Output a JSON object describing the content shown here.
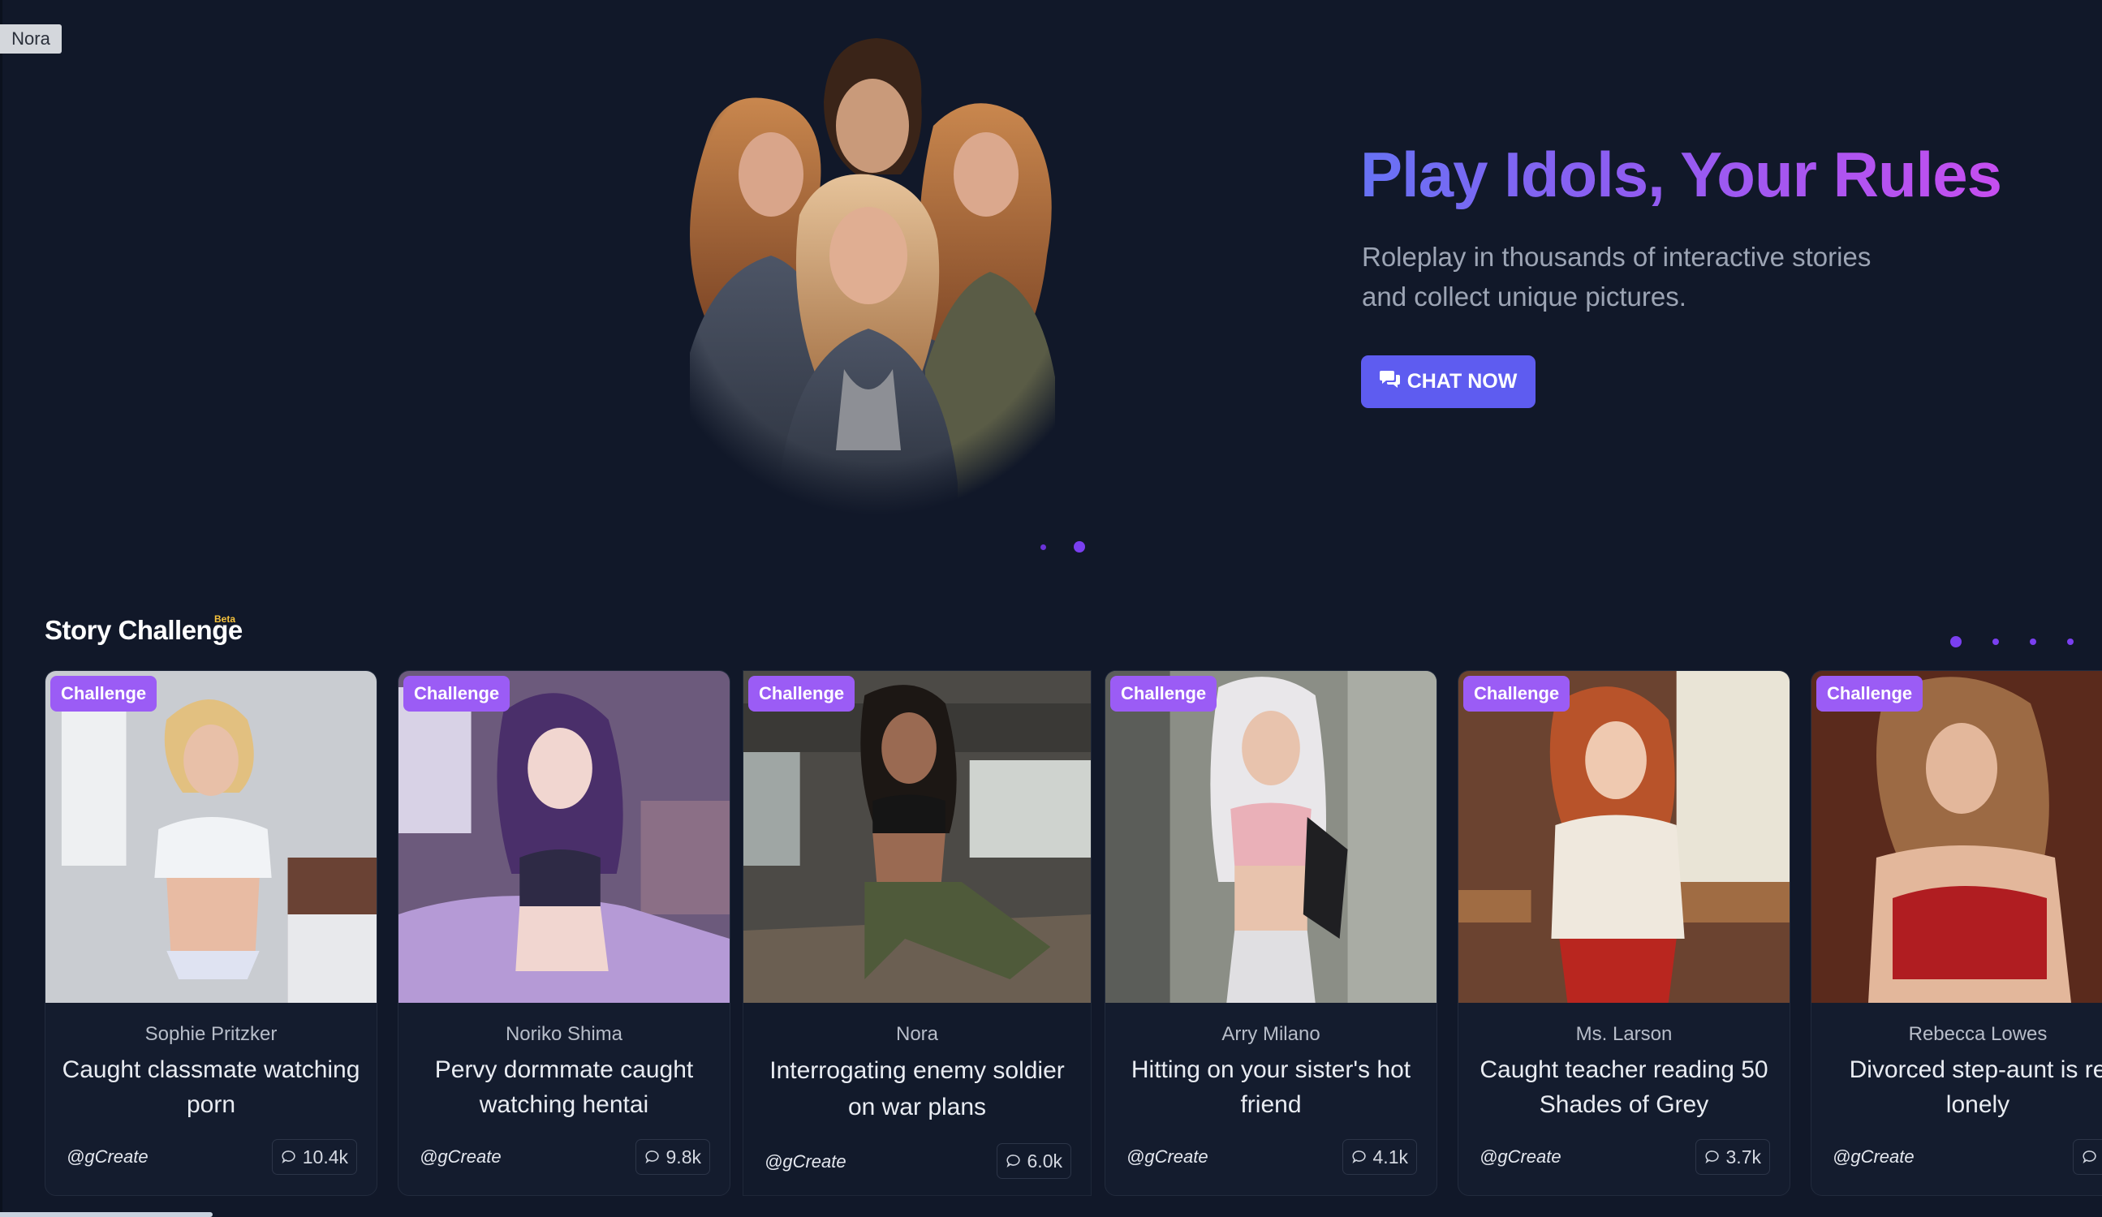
{
  "corner_tag": "Nora",
  "hero": {
    "title": "Play Idols, Your Rules",
    "subtitle_line1": "Roleplay in thousands of interactive stories",
    "subtitle_line2": "and collect unique pictures.",
    "cta_label": "CHAT NOW",
    "carousel_active_index": 1,
    "carousel_count": 2
  },
  "section": {
    "title": "Story Challenge",
    "beta": "Beta",
    "pages": 4,
    "active_page": 0
  },
  "cards": [
    {
      "badge": "Challenge",
      "name": "Sophie Pritzker",
      "title": "Caught classmate watching porn",
      "author": "@gCreate",
      "count": "10.4k"
    },
    {
      "badge": "Challenge",
      "name": "Noriko Shima",
      "title": "Pervy dormmate caught watching hentai",
      "author": "@gCreate",
      "count": "9.8k"
    },
    {
      "badge": "Challenge",
      "name": "Nora",
      "title": "Interrogating enemy soldier on war plans",
      "author": "@gCreate",
      "count": "6.0k"
    },
    {
      "badge": "Challenge",
      "name": "Arry Milano",
      "title": "Hitting on your sister's hot friend",
      "author": "@gCreate",
      "count": "4.1k"
    },
    {
      "badge": "Challenge",
      "name": "Ms. Larson",
      "title": "Caught teacher reading 50 Shades of Grey",
      "author": "@gCreate",
      "count": "3.7k"
    },
    {
      "badge": "Challenge",
      "name": "Rebecca Lowes",
      "title": "Divorced step-aunt is re lonely",
      "author": "@gCreate",
      "count": ""
    }
  ],
  "colors": {
    "background": "#111829",
    "accent": "#5e5cf0",
    "badge": "#9b5cf5",
    "title_gradient_start": "#6772f4",
    "title_gradient_end": "#c64ef0"
  }
}
